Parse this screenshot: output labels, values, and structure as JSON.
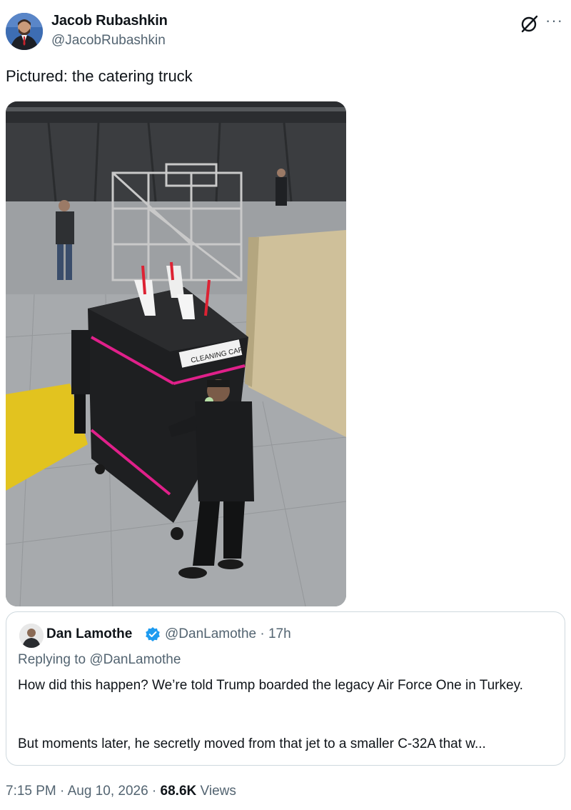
{
  "author": {
    "name": "Jacob Rubashkin",
    "handle": "@JacobRubashkin"
  },
  "tweet": {
    "text": "Pictured: the catering truck"
  },
  "media": {
    "cart_label": "CLEANING CART"
  },
  "quote": {
    "name": "Dan Lamothe",
    "handle_time": "@DanLamothe · 17h",
    "replying_prefix": "Replying to ",
    "replying_to": "@DanLamothe",
    "body_1": "How did this happen? We’re told Trump boarded the legacy Air Force One in Turkey.",
    "body_2": "But moments later, he secretly moved from that jet to a smaller C-32A that w..."
  },
  "meta": {
    "time_date": "7:15 PM · Aug 10, 2026 · ",
    "views_count": "68.6K",
    "views_label": " Views"
  },
  "colors": {
    "text": "#0f1419",
    "secondary": "#536471",
    "verified": "#1d9bf0",
    "border": "#cfd9de"
  },
  "icons": {
    "grok": "grok-icon",
    "more": "more-icon",
    "verified": "verified-badge-icon"
  }
}
